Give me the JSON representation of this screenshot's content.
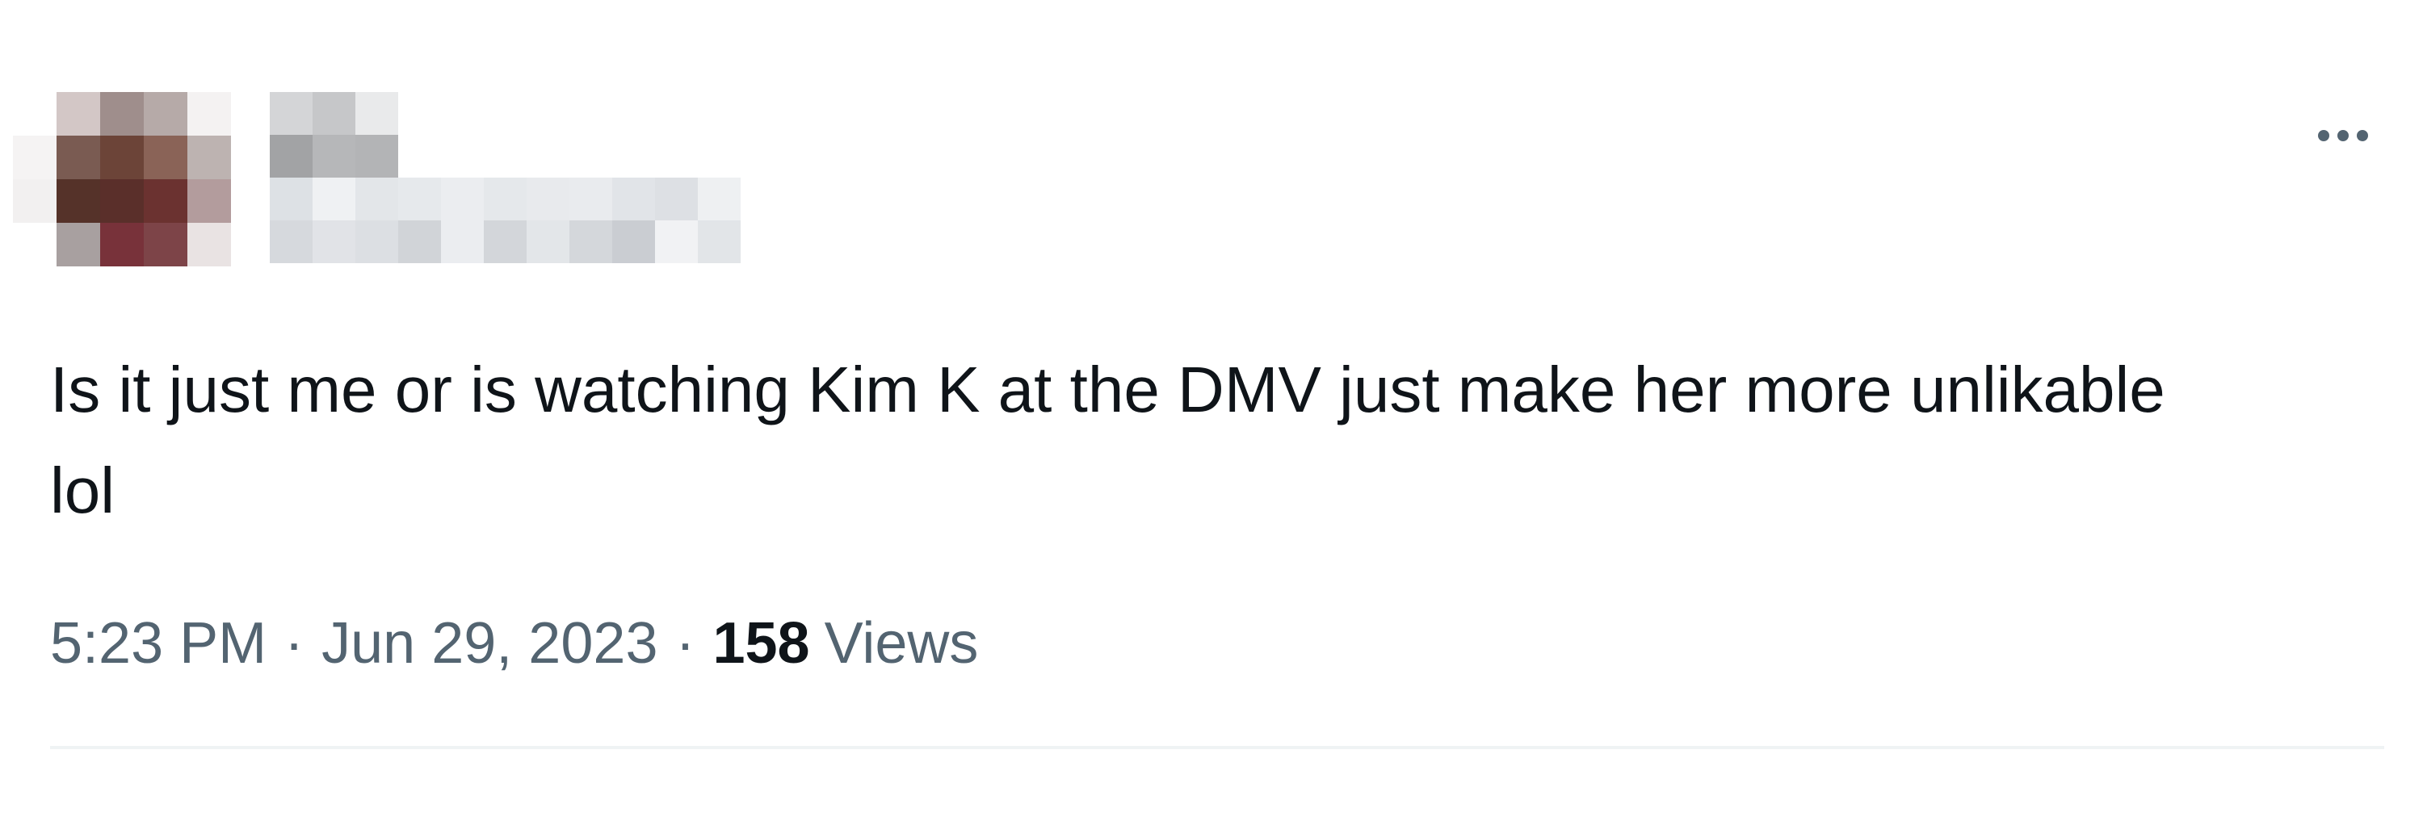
{
  "tweet": {
    "text": "Is it just me or is watching Kim K at the DMV just make her more unlikable lol",
    "time": "5:23 PM",
    "separator": "·",
    "date": "Jun 29, 2023",
    "views_count": "158",
    "views_label": "Views"
  },
  "more_menu": {
    "icon": "more-horizontal-icon"
  },
  "colors": {
    "text_primary": "#0f1419",
    "text_secondary": "#536471",
    "divider": "#eff3f4"
  }
}
